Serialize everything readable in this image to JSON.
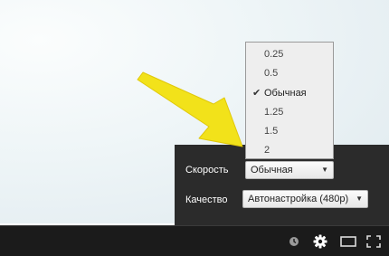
{
  "settings": {
    "speed_label": "Скорость",
    "speed_value": "Обычная",
    "quality_label": "Качество",
    "quality_value": "Автонастройка (480p)"
  },
  "speed_menu": {
    "options": [
      {
        "label": "0.25",
        "selected": false
      },
      {
        "label": "0.5",
        "selected": false
      },
      {
        "label": "Обычная",
        "selected": true
      },
      {
        "label": "1.25",
        "selected": false
      },
      {
        "label": "1.5",
        "selected": false
      },
      {
        "label": "2",
        "selected": false
      }
    ]
  },
  "controls": {
    "icons": [
      "watch-later-icon",
      "gear-icon",
      "theater-mode-icon",
      "fullscreen-icon"
    ]
  },
  "colors": {
    "arrow": "#f2e21a",
    "panel_bg": "#2b2b2b",
    "control_bar_bg": "#1b1b1b"
  }
}
